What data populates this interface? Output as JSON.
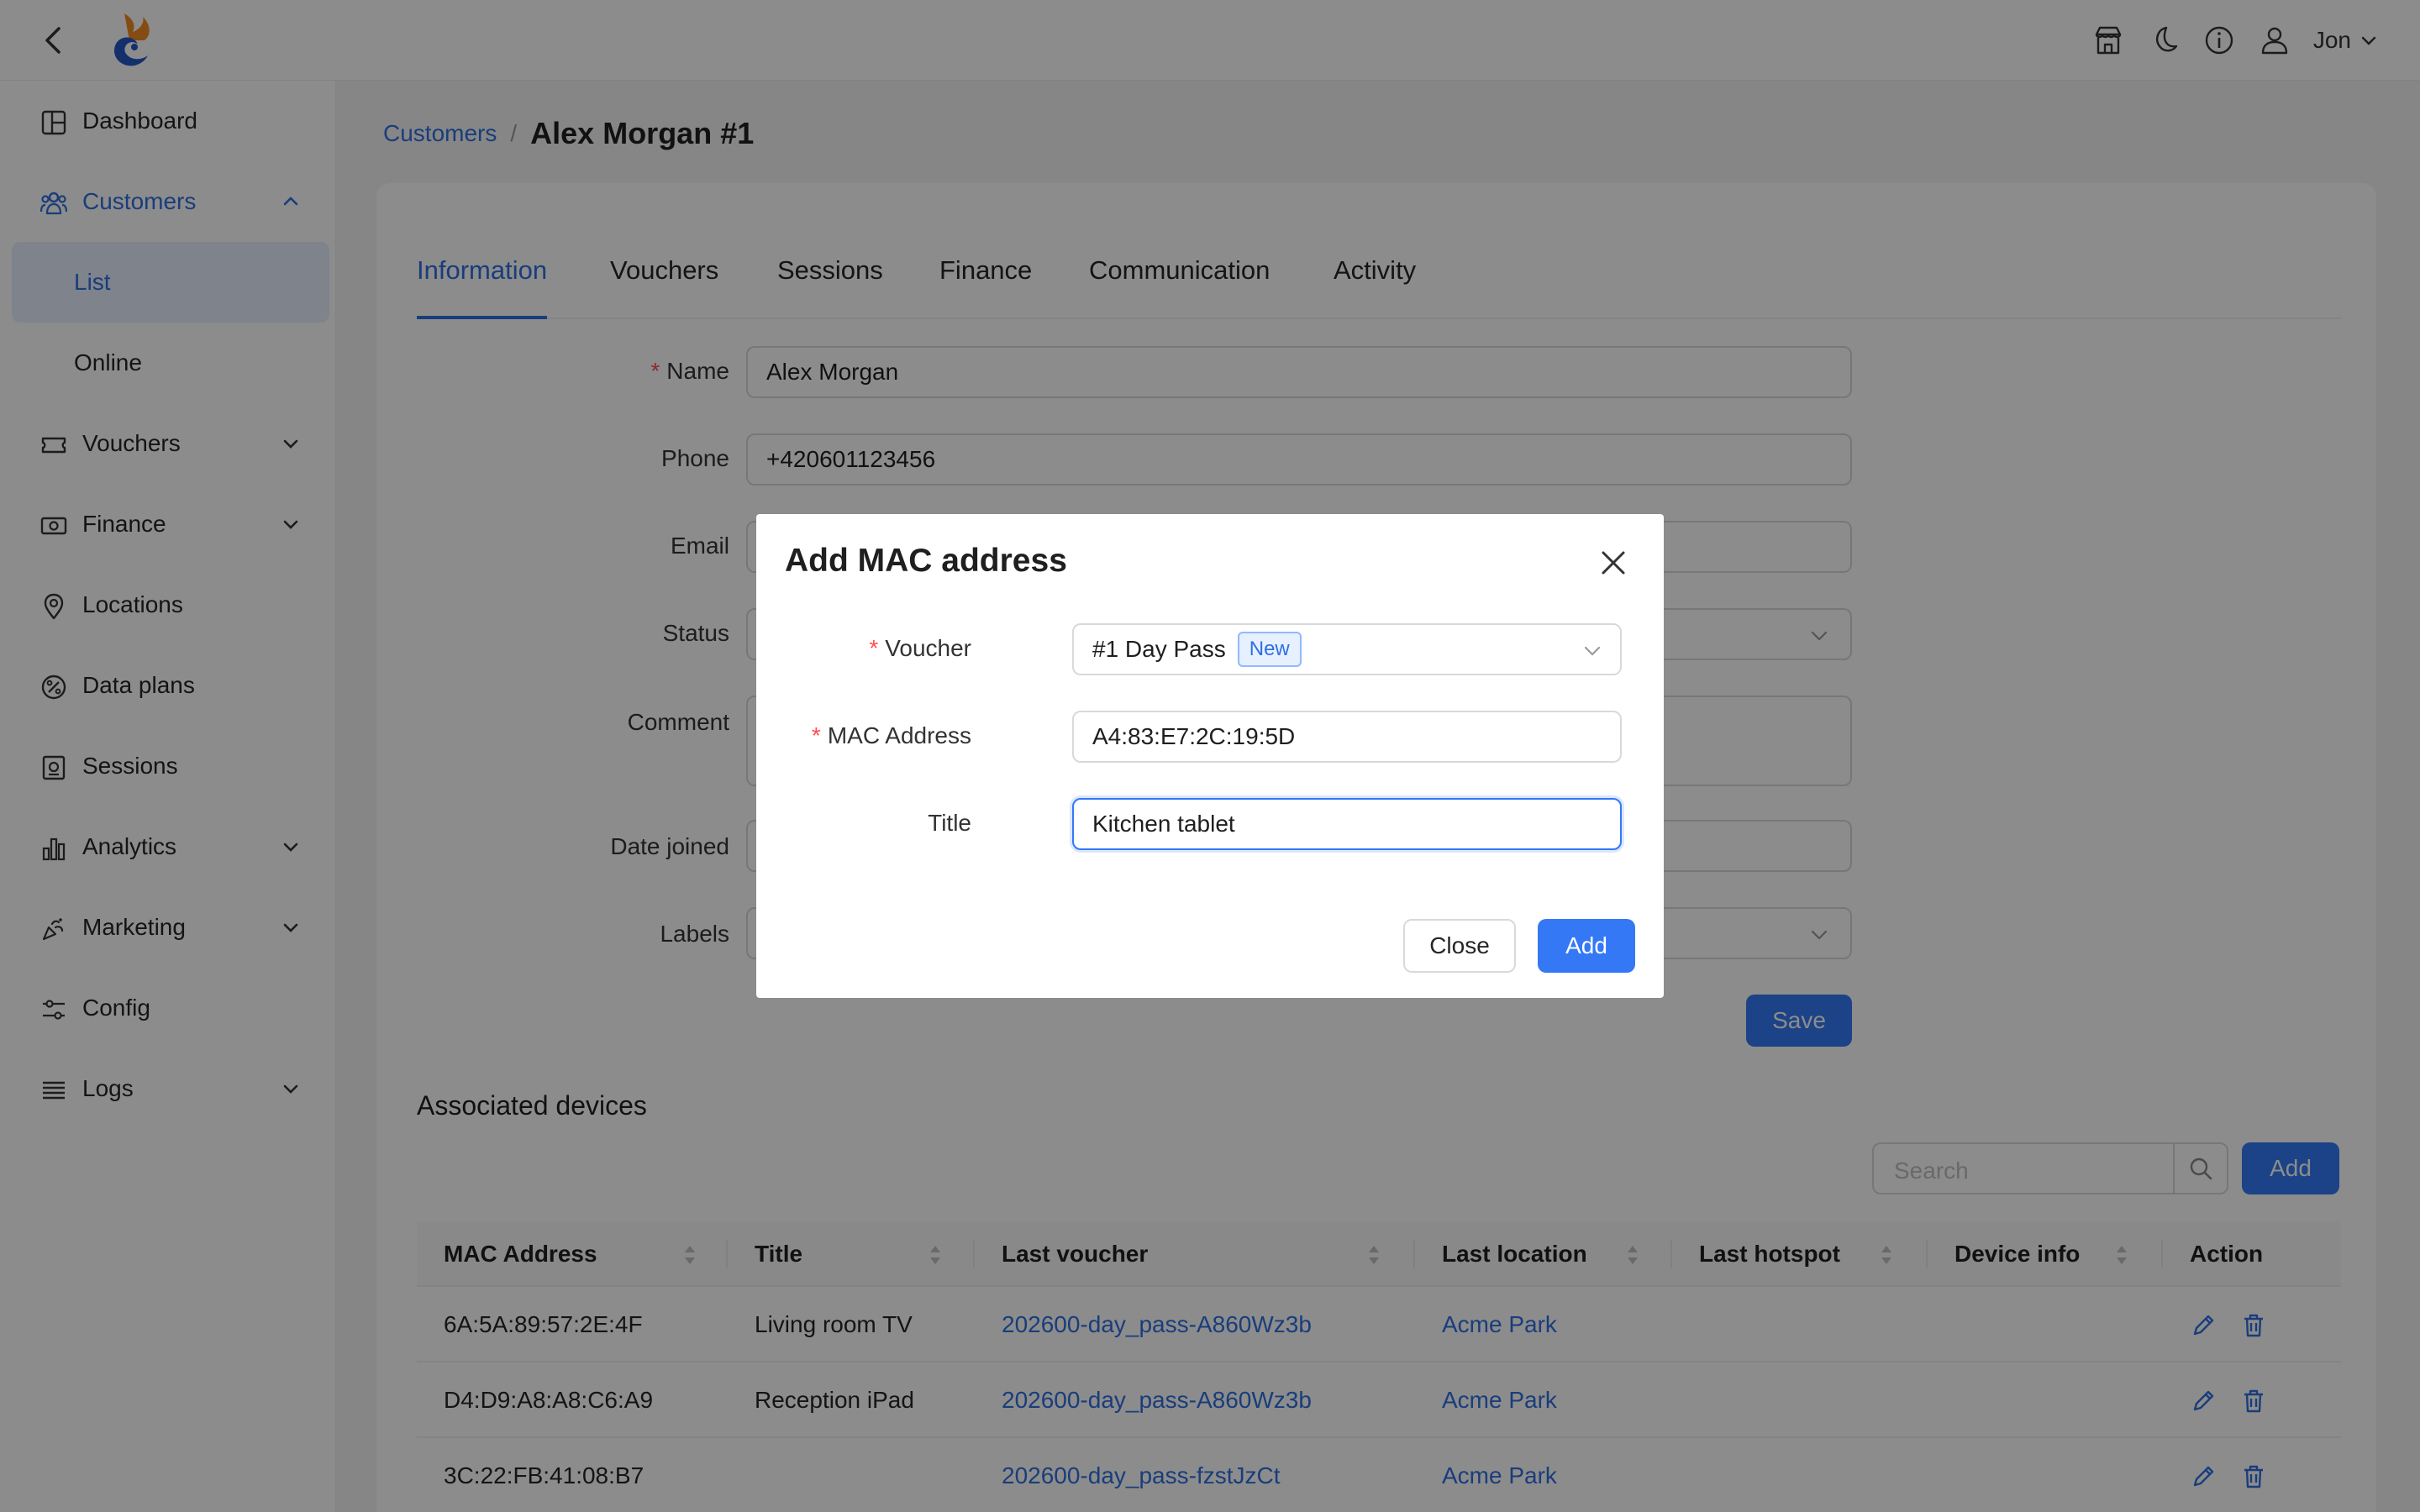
{
  "header": {
    "user_name": "Jon",
    "icons": [
      "store-icon",
      "moon-icon",
      "info-icon",
      "user-icon"
    ]
  },
  "sidebar": {
    "items": [
      {
        "label": "Dashboard",
        "icon": "dashboard-icon"
      },
      {
        "label": "Customers",
        "icon": "customers-icon",
        "expanded": true
      },
      {
        "label": "List",
        "sub": true,
        "selected": true
      },
      {
        "label": "Online",
        "sub": true
      },
      {
        "label": "Vouchers",
        "icon": "voucher-icon"
      },
      {
        "label": "Finance",
        "icon": "money-icon"
      },
      {
        "label": "Locations",
        "icon": "location-icon"
      },
      {
        "label": "Data plans",
        "icon": "data-plan-icon"
      },
      {
        "label": "Sessions",
        "icon": "sessions-icon"
      },
      {
        "label": "Analytics",
        "icon": "analytics-icon"
      },
      {
        "label": "Marketing",
        "icon": "marketing-icon"
      },
      {
        "label": "Config",
        "icon": "config-icon"
      },
      {
        "label": "Logs",
        "icon": "logs-icon"
      }
    ]
  },
  "breadcrumb": {
    "parent": "Customers",
    "separator": "/",
    "current": "Alex Morgan #1"
  },
  "tabs": [
    "Information",
    "Vouchers",
    "Sessions",
    "Finance",
    "Communication",
    "Activity"
  ],
  "form": {
    "name_label": "Name",
    "name_value": "Alex Morgan",
    "phone_label": "Phone",
    "phone_value": "+420601123456",
    "email_label": "Email",
    "status_label": "Status",
    "comment_label": "Comment",
    "date_joined_label": "Date joined",
    "labels_label": "Labels",
    "save_label": "Save"
  },
  "devices": {
    "title": "Associated devices",
    "search_placeholder": "Search",
    "add_label": "Add",
    "columns": [
      "MAC Address",
      "Title",
      "Last voucher",
      "Last location",
      "Last hotspot",
      "Device info",
      "Action"
    ],
    "rows": [
      {
        "mac": "6A:5A:89:57:2E:4F",
        "title": "Living room TV",
        "voucher": "202600-day_pass-A860Wz3b",
        "location": "Acme Park"
      },
      {
        "mac": "D4:D9:A8:A8:C6:A9",
        "title": "Reception iPad",
        "voucher": "202600-day_pass-A860Wz3b",
        "location": "Acme Park"
      },
      {
        "mac": "3C:22:FB:41:08:B7",
        "title": "",
        "voucher": "202600-day_pass-fzstJzCt",
        "location": "Acme Park"
      }
    ]
  },
  "modal": {
    "title": "Add MAC address",
    "voucher_label": "Voucher",
    "voucher_value": "#1 Day Pass",
    "voucher_tag": "New",
    "mac_label": "MAC Address",
    "mac_value": "A4:83:E7:2C:19:5D",
    "title_label": "Title",
    "title_value": "Kitchen tablet",
    "close_label": "Close",
    "add_label": "Add"
  },
  "colors": {
    "accent": "#3478f6",
    "link": "#2f6fe0",
    "required": "#ff4d4f"
  }
}
